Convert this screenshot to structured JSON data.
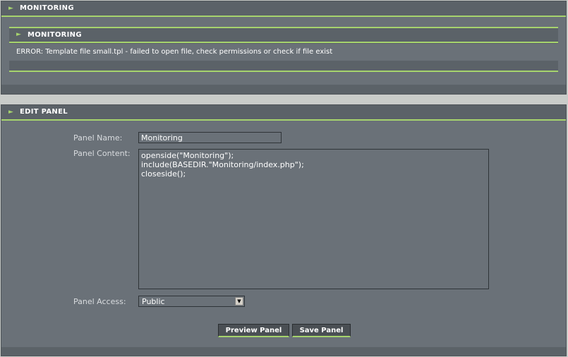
{
  "side_panel": {
    "title": "MONITORING",
    "inner_title": "MONITORING",
    "error_text": "ERROR: Template file small.tpl - failed to open file, check permissions or check if file exist"
  },
  "edit_panel": {
    "title": "EDIT PANEL",
    "name_label": "Panel Name:",
    "name_value": "Monitoring",
    "content_label": "Panel Content:",
    "content_value": "openside(\"Monitoring\");\ninclude(BASEDIR.\"Monitoring/index.php\");\ncloseside();",
    "access_label": "Panel Access:",
    "access_value": "Public",
    "preview_button": "Preview Panel",
    "save_button": "Save Panel"
  },
  "icons": {
    "caption_arrow": "arrow-right-icon",
    "dropdown": "chevron-down-icon"
  },
  "colors": {
    "accent": "#a6d36d",
    "panel_bg": "#6a7178",
    "caption_bg": "#5b6268"
  }
}
